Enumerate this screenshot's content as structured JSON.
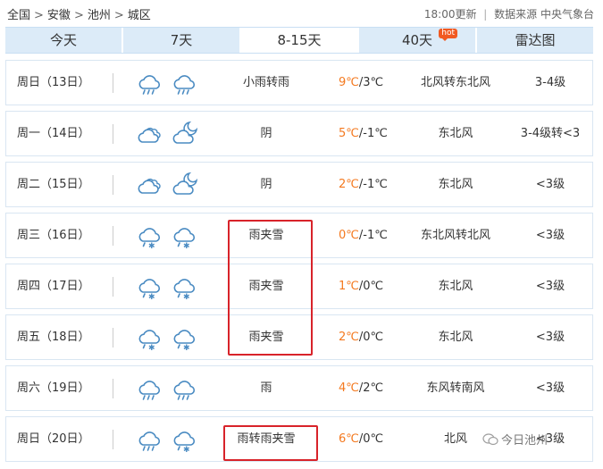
{
  "breadcrumb": [
    "全国",
    "安徽",
    "池州",
    "城区"
  ],
  "breadcrumb_sep": ">",
  "meta": {
    "update": "18:00更新",
    "source": "数据来源 中央气象台",
    "divider": "|"
  },
  "tabs": [
    {
      "label": "今天",
      "active": false,
      "badge": ""
    },
    {
      "label": "7天",
      "active": false,
      "badge": ""
    },
    {
      "label": "8-15天",
      "active": true,
      "badge": ""
    },
    {
      "label": "40天",
      "active": false,
      "badge": "hot"
    },
    {
      "label": "雷达图",
      "active": false,
      "badge": ""
    }
  ],
  "days": [
    {
      "day": "周日（13日）",
      "icons": [
        "cloud-rain-icon",
        "cloud-rain-icon"
      ],
      "desc": "小雨转雨",
      "high": "9℃",
      "low": "3℃",
      "wind": "北风转东北风",
      "level": "3-4级"
    },
    {
      "day": "周一（14日）",
      "icons": [
        "cloud-icon",
        "cloud-moon-icon"
      ],
      "desc": "阴",
      "high": "5℃",
      "low": "-1℃",
      "wind": "东北风",
      "level": "3-4级转<3"
    },
    {
      "day": "周二（15日）",
      "icons": [
        "cloud-icon",
        "cloud-moon-icon"
      ],
      "desc": "阴",
      "high": "2℃",
      "low": "-1℃",
      "wind": "东北风",
      "level": "<3级"
    },
    {
      "day": "周三（16日）",
      "icons": [
        "cloud-sleet-icon",
        "cloud-sleet-icon"
      ],
      "desc": "雨夹雪",
      "high": "0℃",
      "low": "-1℃",
      "wind": "东北风转北风",
      "level": "<3级"
    },
    {
      "day": "周四（17日）",
      "icons": [
        "cloud-sleet-icon",
        "cloud-sleet-icon"
      ],
      "desc": "雨夹雪",
      "high": "1℃",
      "low": "0℃",
      "wind": "东北风",
      "level": "<3级"
    },
    {
      "day": "周五（18日）",
      "icons": [
        "cloud-sleet-icon",
        "cloud-sleet-icon"
      ],
      "desc": "雨夹雪",
      "high": "2℃",
      "low": "0℃",
      "wind": "东北风",
      "level": "<3级"
    },
    {
      "day": "周六（19日）",
      "icons": [
        "cloud-rain-icon",
        "cloud-rain-icon"
      ],
      "desc": "雨",
      "high": "4℃",
      "low": "2℃",
      "wind": "东风转南风",
      "level": "<3级"
    },
    {
      "day": "周日（20日）",
      "icons": [
        "cloud-rain-icon",
        "cloud-sleet-icon"
      ],
      "desc": "雨转雨夹雪",
      "high": "6℃",
      "low": "0℃",
      "wind": "北风",
      "level": "<3级"
    }
  ],
  "watermark": "今日池州",
  "colors": {
    "accent": "#f4791f",
    "highlight": "#d8232a",
    "tab_bg": "#dcebf8",
    "icon_stroke": "#4a8bc2"
  }
}
